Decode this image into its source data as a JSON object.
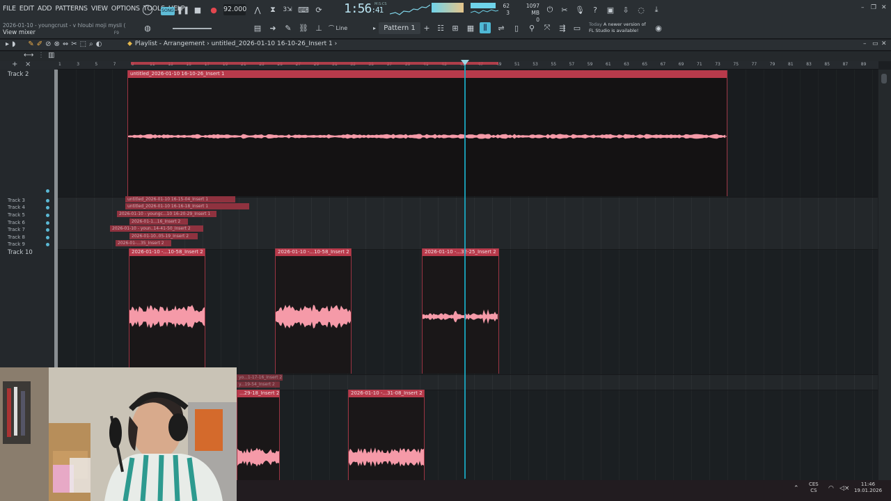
{
  "menu": [
    "FILE",
    "EDIT",
    "ADD",
    "PATTERNS",
    "VIEW",
    "OPTIONS",
    "TOOLS",
    "HELP"
  ],
  "hint": {
    "line1": "2026-01-10 - youngcrust - v hloubi moji mysli (",
    "line2": "View mixer",
    "shortcut": "F9"
  },
  "transport": {
    "song_label": "SONG",
    "tempo": "92.000",
    "time_main": "1:56",
    "time_sub": ":41",
    "time_unit": "M:S:CS"
  },
  "stats": {
    "cpu": "62",
    "cpu_sub": "3",
    "memory": "1097 MB",
    "memory_sub": "0"
  },
  "toolbar": {
    "snap_mode": "Line",
    "pattern": "Pattern 1"
  },
  "news": {
    "today": "Today",
    "message_line1": "A newer version of",
    "message_line2": "FL Studio is available!"
  },
  "playlist": {
    "title": "Playlist - Arrangement",
    "breadcrumb": "untitled_2026-01-10 16-10-26_Insert 1"
  },
  "ruler": [
    "1",
    "3",
    "5",
    "7",
    "9",
    "11",
    "13",
    "15",
    "17",
    "19",
    "21",
    "23",
    "25",
    "27",
    "29",
    "31",
    "33",
    "35",
    "37",
    "39",
    "41",
    "43",
    "45",
    "47",
    "49",
    "51",
    "53",
    "55",
    "57",
    "59",
    "61",
    "63",
    "65",
    "67",
    "69",
    "71",
    "73",
    "75",
    "77",
    "79",
    "81",
    "83",
    "85",
    "87",
    "89"
  ],
  "tracks": {
    "track2": "Track 2",
    "track3": "Track 3",
    "track4": "Track 4",
    "track5": "Track 5",
    "track6": "Track 6",
    "track7": "Track 7",
    "track8": "Track 8",
    "track9": "Track 9",
    "track10": "Track 10"
  },
  "clips": {
    "main": "untitled_2026-01-10 16-10-26_Insert 1",
    "t3": "untitled_2026-01-10 16-15-04_Insert 1",
    "t4": "untitled_2026-01-10 16-16-18_Insert 1",
    "t5": "2026-01-10 - youngc...10 16-20-29_Insert 1",
    "t6": "2026-01-1...16_Insert 2",
    "t7": "2026-01-10 - youn..14-41-50_Insert 2",
    "t8": "2026-01-10..05-19_Insert 2",
    "t9": "2026-01-...35_Insert 2",
    "c10a": "2026-01-10 -...10-58_Insert 2",
    "c10b": "2026-01-10 -...10-58_Insert 2",
    "c10c": "2026-01-10 -...32-25_Insert 2",
    "l1": "yo...1-17-16_Insert 2",
    "l2": "y...19-54_Insert 2",
    "c11a": "...29-18_Insert 2",
    "c11b": "2026-01-10 -...31-08_Insert 2"
  },
  "tray": {
    "lang1": "CES",
    "lang2": "CS",
    "time": "11:46",
    "date": "19.01.2026"
  },
  "colors": {
    "clip": "#b83a4b",
    "wave": "#f59aa8",
    "playhead": "#1aa9c2",
    "accent": "#5fbcd6"
  }
}
